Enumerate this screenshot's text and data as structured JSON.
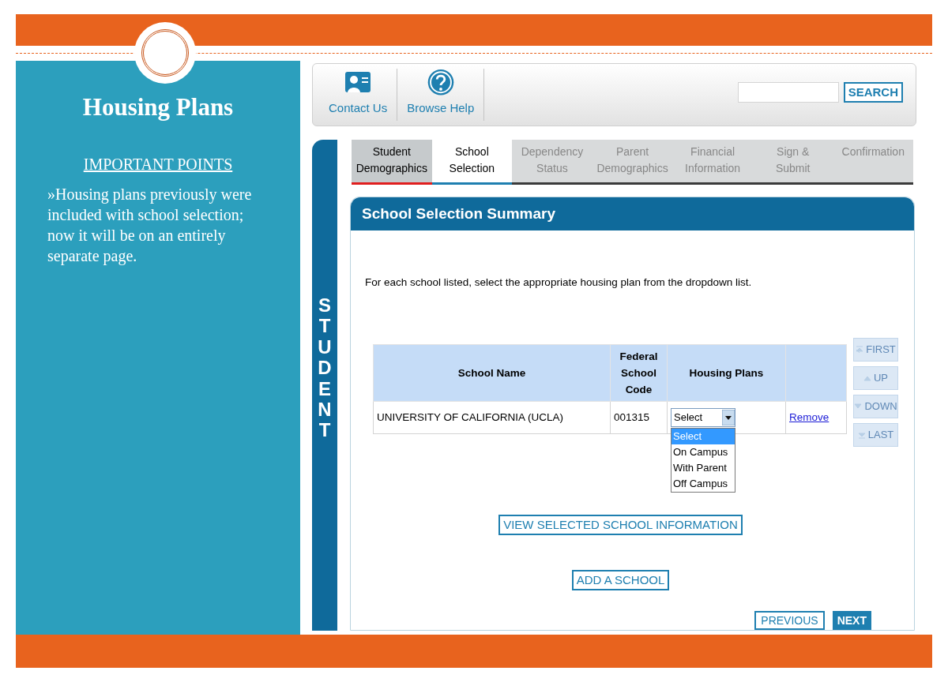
{
  "slide": {
    "title": "Housing Plans",
    "subtitle": "IMPORTANT POINTS",
    "bullets": [
      "»Housing plans previously were included with school selection; now it will be on an entirely separate page."
    ]
  },
  "toolbar": {
    "links": [
      {
        "label": "Contact Us",
        "kind": "contact"
      },
      {
        "label": "Browse Help",
        "kind": "help"
      }
    ],
    "search_button": "SEARCH"
  },
  "side_label": "STUDENT",
  "tabs": [
    {
      "label": "Student\nDemographics",
      "selected": false,
      "completed": true
    },
    {
      "label": "School\nSelection",
      "selected": true,
      "completed": false
    },
    {
      "label": "Dependency\nStatus",
      "selected": false,
      "completed": false
    },
    {
      "label": "Parent\nDemographics",
      "selected": false,
      "completed": false
    },
    {
      "label": "Financial\nInformation",
      "selected": false,
      "completed": false
    },
    {
      "label": "Sign &\nSubmit",
      "selected": false,
      "completed": false
    },
    {
      "label": "Confirmation",
      "selected": false,
      "completed": false
    }
  ],
  "panel": {
    "title": "School Selection Summary",
    "instructions": "For each school listed, select the appropriate housing plan from the dropdown list.",
    "table": {
      "columns": [
        "School Name",
        "Federal\nSchool\nCode",
        "Housing Plans"
      ],
      "rows": [
        {
          "school_name": "UNIVERSITY OF CALIFORNIA (UCLA)",
          "code": "001315",
          "housing": {
            "value": "Select",
            "expanded": true,
            "options": [
              {
                "label": "Select",
                "selected": true
              },
              {
                "label": "On Campus",
                "selected": false
              },
              {
                "label": "With Parent",
                "selected": false
              },
              {
                "label": "Off Campus",
                "selected": false
              }
            ]
          },
          "action": "Remove"
        }
      ]
    },
    "order_buttons": [
      {
        "label": "FIRST",
        "kind": "first",
        "disabled": true
      },
      {
        "label": "UP",
        "kind": "up",
        "disabled": true
      },
      {
        "label": "DOWN",
        "kind": "down",
        "disabled": true
      },
      {
        "label": "LAST",
        "kind": "last",
        "disabled": true
      }
    ],
    "buttons": [
      "VIEW SELECTED SCHOOL INFORMATION",
      "ADD A SCHOOL"
    ],
    "nav": {
      "previous": "PREVIOUS",
      "next": "NEXT"
    }
  }
}
